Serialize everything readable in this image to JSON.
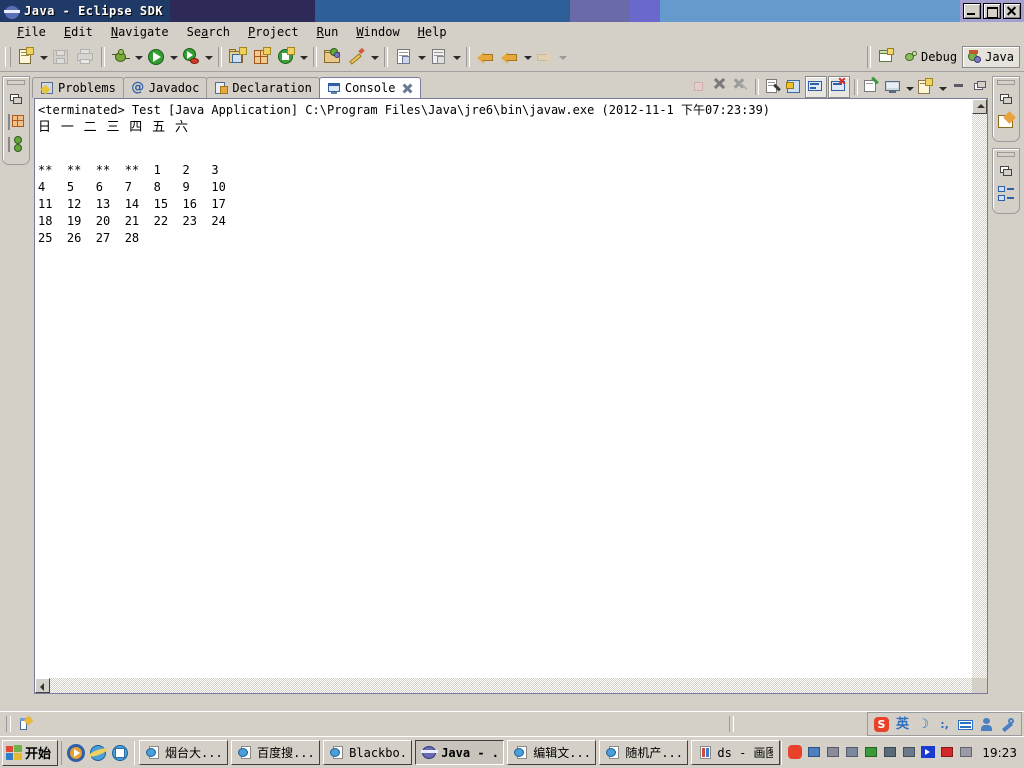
{
  "window": {
    "title": "Java - Eclipse SDK",
    "title_segments": [
      "#1f3a66",
      "#2d2a57",
      "#2f5f99",
      "#6a6aa8",
      "#6a68cc",
      "#6699cc",
      "#a5a0cf",
      "#a9d4cd",
      "#a8cdf5"
    ],
    "controls": {
      "minimize": "Minimize",
      "maximize": "Maximize",
      "close": "Close"
    }
  },
  "menu": {
    "items": [
      {
        "label": "File",
        "mnemonic": "F"
      },
      {
        "label": "Edit",
        "mnemonic": "E"
      },
      {
        "label": "Navigate",
        "mnemonic": "N"
      },
      {
        "label": "Search",
        "mnemonic": "a"
      },
      {
        "label": "Project",
        "mnemonic": "P"
      },
      {
        "label": "Run",
        "mnemonic": "R"
      },
      {
        "label": "Window",
        "mnemonic": "W"
      },
      {
        "label": "Help",
        "mnemonic": "H"
      }
    ]
  },
  "toolbar": {
    "buttons": [
      {
        "name": "new-wizard",
        "icon": "new-file-icon",
        "dropdown": true
      },
      {
        "name": "save",
        "icon": "save-icon",
        "dropdown": false,
        "disabled": true
      },
      {
        "name": "print",
        "icon": "print-icon",
        "dropdown": false,
        "disabled": true
      },
      {
        "name": "debug",
        "icon": "debug-bug-icon",
        "dropdown": true
      },
      {
        "name": "run",
        "icon": "run-green-play-icon",
        "dropdown": true
      },
      {
        "name": "run-external-tool",
        "icon": "external-tools-icon",
        "dropdown": true
      },
      {
        "name": "new-java-project",
        "icon": "new-java-project-icon",
        "dropdown": false
      },
      {
        "name": "new-package",
        "icon": "new-package-icon",
        "dropdown": false
      },
      {
        "name": "new-java-class",
        "icon": "new-class-icon",
        "dropdown": true
      },
      {
        "name": "open-type",
        "icon": "open-type-icon",
        "dropdown": false
      },
      {
        "name": "quick-edit",
        "icon": "pencil-icon",
        "dropdown": true
      },
      {
        "name": "next-annotation",
        "icon": "next-annotation-icon",
        "dropdown": true
      },
      {
        "name": "prev-annotation",
        "icon": "prev-annotation-icon",
        "dropdown": true
      },
      {
        "name": "back-history",
        "icon": "back-arrow-icon",
        "dropdown": false
      },
      {
        "name": "last-edit",
        "icon": "last-edit-arrow-icon",
        "dropdown": true
      },
      {
        "name": "forward-history",
        "icon": "forward-arrow-icon",
        "dropdown": true,
        "disabled": true
      }
    ],
    "perspectives": {
      "open_label": "",
      "items": [
        {
          "label": "Debug",
          "icon": "debug-perspective-icon",
          "active": false
        },
        {
          "label": "Java",
          "icon": "java-perspective-icon",
          "active": true
        }
      ]
    }
  },
  "rails": {
    "left": {
      "restore_label": "Restore",
      "icons": [
        {
          "name": "restore-view-icon"
        },
        {
          "name": "package-explorer-icon"
        },
        {
          "name": "hierarchy-icon"
        }
      ]
    },
    "right_groups": [
      {
        "icons": [
          {
            "name": "restore-view-icon"
          },
          {
            "name": "task-list-icon"
          }
        ]
      },
      {
        "icons": [
          {
            "name": "restore-view-icon"
          },
          {
            "name": "outline-icon"
          }
        ]
      }
    ]
  },
  "view_tabs": [
    {
      "label": "Problems",
      "icon": "problems-icon",
      "active": false,
      "closable": false
    },
    {
      "label": "Javadoc",
      "icon": "javadoc-at-icon",
      "active": false,
      "closable": false
    },
    {
      "label": "Declaration",
      "icon": "declaration-icon",
      "active": false,
      "closable": false
    },
    {
      "label": "Console",
      "icon": "console-icon",
      "active": true,
      "closable": true
    }
  ],
  "view_toolbar": [
    {
      "name": "terminate-button",
      "icon": "terminate-red-icon",
      "disabled": true
    },
    {
      "name": "remove-launch-button",
      "icon": "remove-launch-icon",
      "disabled": false
    },
    {
      "name": "remove-all-launch-button",
      "icon": "remove-all-icon",
      "disabled": false
    },
    {
      "name": "clear-console-button",
      "icon": "clear-console-icon",
      "disabled": false
    },
    {
      "name": "scroll-lock-button",
      "icon": "scroll-lock-icon",
      "disabled": false
    },
    {
      "name": "show-console-on-out-button",
      "icon": "console-out-icon",
      "pressed": true
    },
    {
      "name": "show-console-on-err-button",
      "icon": "console-err-icon",
      "pressed": true
    },
    {
      "name": "pin-console-button",
      "icon": "pin-console-icon",
      "disabled": false
    },
    {
      "name": "display-selected-console-button",
      "icon": "display-console-icon",
      "dropdown": true
    },
    {
      "name": "open-console-button",
      "icon": "open-console-icon",
      "dropdown": true
    },
    {
      "name": "minimize-view-button",
      "icon": "minimize-icon",
      "disabled": false
    },
    {
      "name": "maximize-view-button",
      "icon": "maximize-icon",
      "disabled": false
    }
  ],
  "console": {
    "terminated_line": "<terminated> Test [Java Application] C:\\Program Files\\Java\\jre6\\bin\\javaw.exe (2012-11-1 下午07:23:39)",
    "weekday_header": "日 一 二 三 四 五 六",
    "calendar_rows": [
      "**  **  **  **  1   2   3",
      "4   5   6   7   8   9   10",
      "11  12  13  14  15  16  17",
      "18  19  20  21  22  23  24",
      "25  26  27  28"
    ],
    "scrollbars": {
      "vertical": "console-vertical-scrollbar",
      "horizontal": "console-horizontal-scrollbar"
    }
  },
  "statusbar": {
    "icon": "writable-indicator-icon",
    "text": ""
  },
  "ime": {
    "icons": [
      {
        "name": "sogou-logo-icon",
        "glyph": "S"
      },
      {
        "name": "input-mode-icon",
        "glyph": "英"
      },
      {
        "name": "moon-icon",
        "glyph": "☽"
      },
      {
        "name": "punctuation-icon",
        "glyph": ":,"
      },
      {
        "name": "soft-keyboard-icon",
        "glyph": ""
      },
      {
        "name": "user-icon",
        "glyph": ""
      },
      {
        "name": "toolbox-icon",
        "glyph": ""
      }
    ]
  },
  "taskbar": {
    "start_label": "开始",
    "quick_launch": [
      {
        "name": "media-player-icon"
      },
      {
        "name": "internet-explorer-icon"
      },
      {
        "name": "show-desktop-icon"
      }
    ],
    "tasks": [
      {
        "label": "烟台大...",
        "icon": "ie-page-icon",
        "active": false
      },
      {
        "label": "百度搜...",
        "icon": "ie-page-icon",
        "active": false
      },
      {
        "label": "Blackbo...",
        "icon": "ie-page-icon",
        "active": false
      },
      {
        "label": "Java - ...",
        "icon": "eclipse-icon",
        "active": true
      },
      {
        "label": "编辑文...",
        "icon": "ie-page-icon",
        "active": false
      },
      {
        "label": "随机产...",
        "icon": "ie-page-icon",
        "active": false
      },
      {
        "label": "ds - 画图",
        "icon": "paint-icon",
        "active": false
      }
    ],
    "tray": [
      {
        "name": "sogou-tray-icon"
      },
      {
        "name": "network-icon"
      },
      {
        "name": "monitor-icon"
      },
      {
        "name": "disc-icon"
      },
      {
        "name": "leaf-green-icon"
      },
      {
        "name": "player-tray-icon"
      },
      {
        "name": "calendar-tray-icon"
      },
      {
        "name": "play-blue-icon"
      },
      {
        "name": "antivirus-icon"
      },
      {
        "name": "gray-disc-icon"
      }
    ],
    "clock": "19:23"
  }
}
